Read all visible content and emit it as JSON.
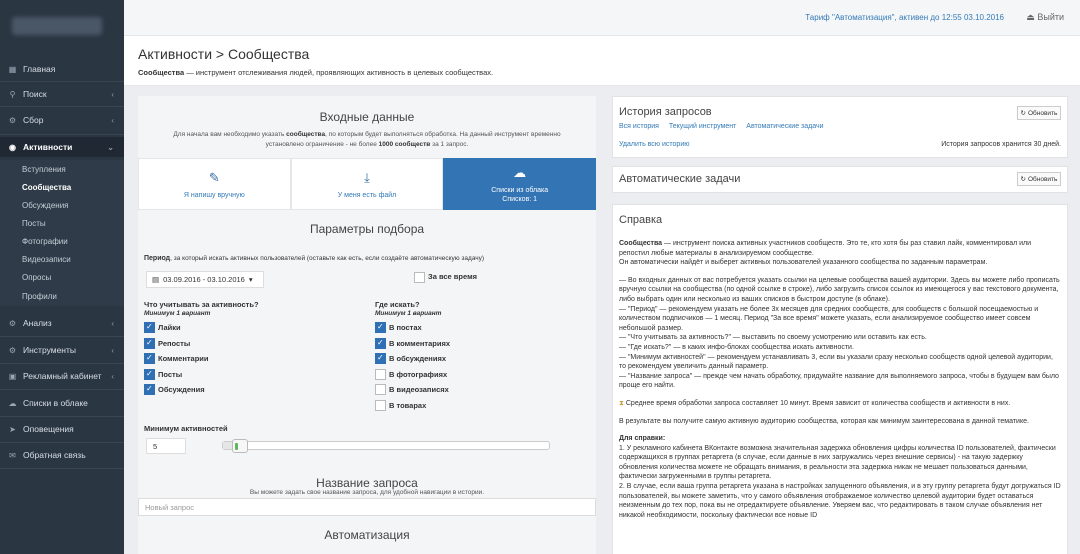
{
  "topbar": {
    "tariff": "Тариф \"Автоматизация\", активен до 12:55 03.10.2016",
    "logout": "Выйти"
  },
  "sidebar": {
    "items": [
      {
        "label": "Главная",
        "icon": "grid-icon"
      },
      {
        "label": "Поиск",
        "icon": "search-icon"
      },
      {
        "label": "Сбор",
        "icon": "gear-icon"
      },
      {
        "label": "Активности",
        "icon": "eye-icon"
      },
      {
        "label": "Анализ",
        "icon": "gear-icon"
      },
      {
        "label": "Инструменты",
        "icon": "gear-icon"
      },
      {
        "label": "Рекламный кабинет",
        "icon": "briefcase-icon"
      },
      {
        "label": "Списки в облаке",
        "icon": "cloud-icon"
      },
      {
        "label": "Оповещения",
        "icon": "send-icon"
      },
      {
        "label": "Обратная связь",
        "icon": "envelope-icon"
      }
    ],
    "subitems": [
      "Вступления",
      "Сообщества",
      "Обсуждения",
      "Посты",
      "Фотографии",
      "Видеозаписи",
      "Опросы",
      "Профили"
    ]
  },
  "page": {
    "title": "Активности > Сообщества",
    "desc_bold": "Сообщества",
    "desc_rest": " — инструмент отслеживания людей, проявляющих активность в целевых сообществах."
  },
  "input": {
    "title": "Входные данные",
    "hint_1": "Для начала вам необходимо указать ",
    "hint_b1": "сообщества",
    "hint_2": ", по которым будет выполняться обработка. На данный инструмент временно установлено ограничение - не более ",
    "hint_b2": "1000 сообществ",
    "hint_3": " за 1 запрос.",
    "tabs": [
      {
        "label": "Я напишу вручную",
        "icon": "pencil-icon"
      },
      {
        "label": "У меня есть файл",
        "icon": "download-icon"
      },
      {
        "label": "Списки из облака",
        "sub": "Списков: 1",
        "icon": "cloud-icon"
      }
    ]
  },
  "params": {
    "title": "Параметры подбора",
    "period_bold": "Период",
    "period_rest": ", за который искать активных пользователей (оставьте как есть, если создаёте автоматическую задачу)",
    "date_range": "03.09.2016 - 03.10.2016",
    "all_time": "За все время",
    "what_head": "Что учитывать за активность?",
    "what_sub": "Минимум 1 вариант",
    "what": [
      {
        "label": "Лайки",
        "checked": true
      },
      {
        "label": "Репосты",
        "checked": true
      },
      {
        "label": "Комментарии",
        "checked": true
      },
      {
        "label": "Посты",
        "checked": true
      },
      {
        "label": "Обсуждения",
        "checked": true
      }
    ],
    "where_head": "Где искать?",
    "where_sub": "Минимум 1 вариант",
    "where": [
      {
        "label": "В постах",
        "checked": true
      },
      {
        "label": "В комментариях",
        "checked": true
      },
      {
        "label": "В обсуждениях",
        "checked": true
      },
      {
        "label": "В фотографиях",
        "checked": false
      },
      {
        "label": "В видеозаписях",
        "checked": false
      },
      {
        "label": "В товарах",
        "checked": false
      }
    ],
    "min_label": "Минимум активностей",
    "min_value": "5",
    "min_slider_fraction": 0.03
  },
  "request_name": {
    "title": "Название запроса",
    "hint": "Вы можете задать свое название запроса, для удобной навигации в истории.",
    "placeholder": "Новый запрос"
  },
  "automation": {
    "title": "Автоматизация"
  },
  "history": {
    "title": "История запросов",
    "refresh": "Обновить",
    "links": [
      "Вся история",
      "Текущий инструмент",
      "Автоматические задачи"
    ],
    "clear": "Удалить всю историю",
    "note": "История запросов хранится 30 дней."
  },
  "auto_tasks": {
    "title": "Автоматические задачи",
    "refresh": "Обновить"
  },
  "help": {
    "title": "Справка",
    "p1_bold": "Сообщества",
    "p1": " — инструмент поиска активных участников сообществ. Это те, кто хотя бы раз ставил лайк, комментировал или репостил любые материалы в анализируемом сообществе.",
    "p1b": "Он автоматически найдёт и выберет активных пользователей указанного сообщества по заданным параметрам.",
    "p2": "— Во входных данных от вас потребуется указать ссылки на целевые сообщества вашей аудитории. Здесь вы можете либо прописать вручную ссылки на сообщества (по одной ссылке в строке), либо загрузить список ссылок из имеющегося у вас текстового документа, либо выбрать один или несколько из ваших списков в быстром доступе (в облаке).",
    "p3": "— \"Период\" — рекомендуем указать не более 3х месяцев для средних сообществ, для сообществ с большой посещаемостью и количеством подписчиков — 1 месяц. Период \"За все время\" можете указать, если анализируемое сообщество имеет совсем небольшой размер.",
    "p4": "— \"Что учитывать за активность?\" — выставить по своему усмотрению или оставить как есть.",
    "p5": "— \"Где искать?\" — в каких инфо-блоках сообщества искать активности.",
    "p6": "— \"Минимум активностей\" — рекомендуем устанавливать 3, если вы указали сразу несколько сообществ одной целевой аудитории, то рекомендуем увеличить данный параметр.",
    "p7": "— \"Название запроса\" — прежде чем начать обработку, придумайте название для выполняемого запроса, чтобы в будущем вам было проще его найти.",
    "p8": "Среднее время обработки запроса составляет 10 минут. Время зависит от количества сообществ и активности в них.",
    "p9": "В результате вы получите самую активную аудиторию сообщества, которая как минимум заинтересована в данной тематике.",
    "p10_head": "Для справки:",
    "p10": "1. У рекламного кабинета ВКонтакте возможна значительная задержка обновления цифры количества ID пользователей, фактически содержащихся в группах ретаргета (в случае, если данные в них загружались через внешние сервисы) - на такую задержку обновления количества можете не обращать внимания, в реальности эта задержка никак не мешает пользоваться данными, фактически загруженными в группы ретаргета.",
    "p11": "2. В случае, если ваша группа ретаргета указана в настройках запущенного объявления, и в эту группу ретаргета будут догружаться ID пользователей, вы можете заметить, что у самого объявления отображаемое количество целевой аудитории будет оставаться неизменным до тех пор, пока вы не отредактируете объявление. Уверяем вас, что редактировать в таком случае объявления нет никакой необходимости, поскольку фактически все новые ID"
  }
}
